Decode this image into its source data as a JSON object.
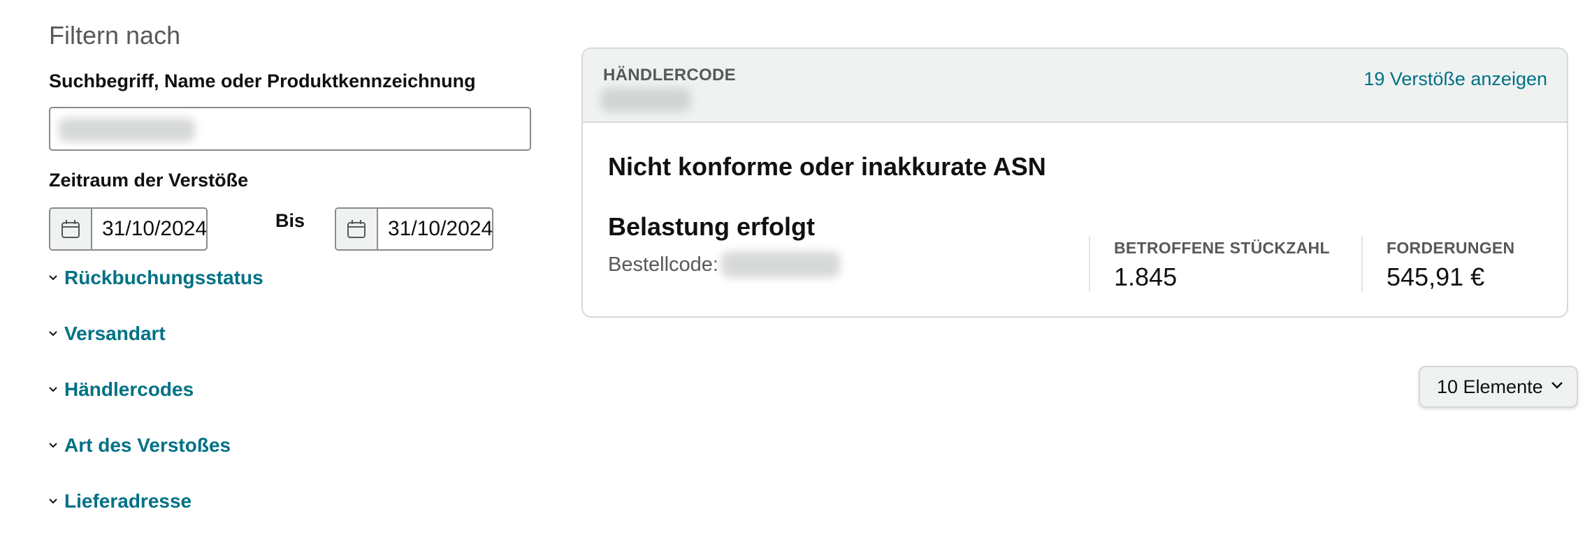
{
  "filter": {
    "heading": "Filtern nach",
    "search_label": "Suchbegriff, Name oder Produktkennzeichnung",
    "search_value": "",
    "date_range_label": "Zeitraum der Verstöße",
    "date_from": "31/10/2024",
    "to_label": "Bis",
    "date_to": "31/10/2024",
    "sections": [
      {
        "label": "Rückbuchungsstatus"
      },
      {
        "label": "Versandart"
      },
      {
        "label": "Händlercodes"
      },
      {
        "label": "Art des Verstoßes"
      },
      {
        "label": "Lieferadresse"
      }
    ]
  },
  "card": {
    "merchant_code_label": "HÄNDLERCODE",
    "view_violations_link": "19 Verstöße anzeigen",
    "title": "Nicht konforme oder inakkurate ASN",
    "charge_status": "Belastung erfolgt",
    "order_code_label": "Bestellcode:",
    "affected_units_label": "BETROFFENE STÜCKZAHL",
    "affected_units_value": "1.845",
    "claims_label": "FORDERUNGEN",
    "claims_value": "545,91 €"
  },
  "pagination": {
    "page_size_label": "10 Elemente"
  },
  "colors": {
    "link": "#007185",
    "muted_text": "#565959",
    "header_bg": "#f0f2f2",
    "border": "#d5d9d9"
  },
  "icons": {
    "calendar": "calendar-icon",
    "chevron": "chevron-down-icon"
  }
}
